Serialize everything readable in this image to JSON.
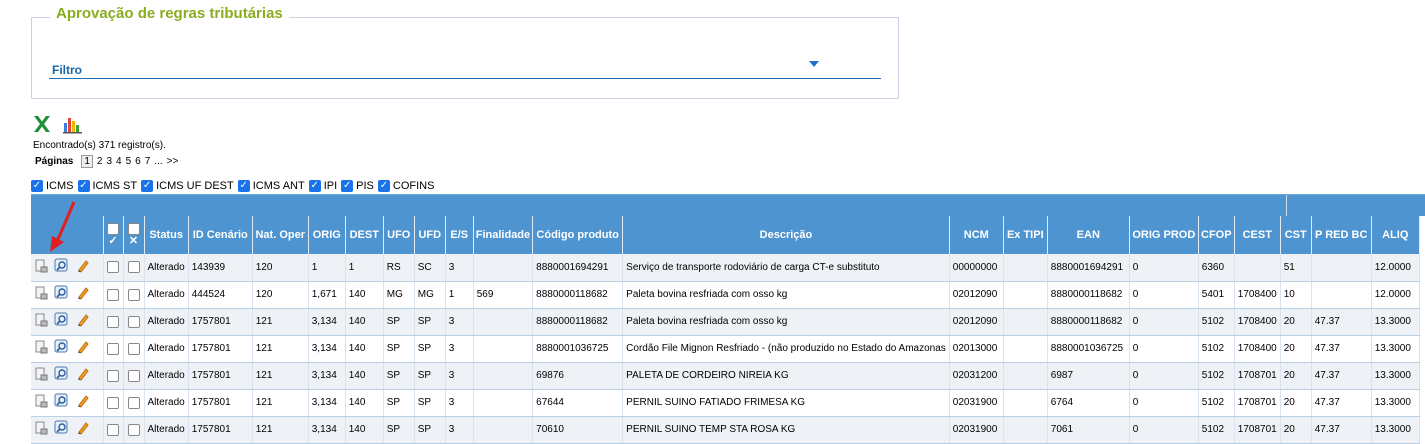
{
  "filter": {
    "title": "Aprovação de regras tributárias",
    "label": "Filtro"
  },
  "toolbar": {
    "excel_icon": "excel-icon",
    "chart_icon": "bar-chart-icon"
  },
  "summary": {
    "found_text": "Encontrado(s) 371 registro(s).",
    "pages_label": "Páginas",
    "pages": [
      "1",
      "2",
      "3",
      "4",
      "5",
      "6",
      "7",
      "...",
      ">>"
    ],
    "current_page": "1"
  },
  "tax_filters": [
    {
      "label": "ICMS",
      "checked": true
    },
    {
      "label": "ICMS ST",
      "checked": true
    },
    {
      "label": "ICMS UF DEST",
      "checked": true
    },
    {
      "label": "ICMS ANT",
      "checked": true
    },
    {
      "label": "IPI",
      "checked": true
    },
    {
      "label": "PIS",
      "checked": true
    },
    {
      "label": "COFINS",
      "checked": true
    }
  ],
  "columns": [
    "Status",
    "ID Cenário",
    "Nat. Oper",
    "ORIG",
    "DEST",
    "UFO",
    "UFD",
    "E/S",
    "Finalidade",
    "Código produto",
    "Descrição",
    "NCM",
    "Ex TIPI",
    "EAN",
    "ORIG PROD",
    "CFOP",
    "CEST",
    "CST",
    "P RED BC",
    "ALIQ"
  ],
  "header_check_symbols": {
    "check": "✓",
    "cross": "✕"
  },
  "rows": [
    [
      "Alterado",
      "143939",
      "120",
      "1",
      "1",
      "RS",
      "SC",
      "3",
      "",
      "8880001694291",
      "Serviço de transporte rodoviário de carga CT-e substituto",
      "00000000",
      "",
      "8880001694291",
      "0",
      "6360",
      "",
      "51",
      "",
      "12.0000"
    ],
    [
      "Alterado",
      "444524",
      "120",
      "1,671",
      "140",
      "MG",
      "MG",
      "1",
      "569",
      "8880000118682",
      "Paleta bovina resfriada com osso kg",
      "02012090",
      "",
      "8880000118682",
      "0",
      "5401",
      "1708400",
      "10",
      "",
      "12.0000"
    ],
    [
      "Alterado",
      "1757801",
      "121",
      "3,134",
      "140",
      "SP",
      "SP",
      "3",
      "",
      "8880000118682",
      "Paleta bovina resfriada com osso kg",
      "02012090",
      "",
      "8880000118682",
      "0",
      "5102",
      "1708400",
      "20",
      "47.37",
      "13.3000"
    ],
    [
      "Alterado",
      "1757801",
      "121",
      "3,134",
      "140",
      "SP",
      "SP",
      "3",
      "",
      "8880001036725",
      "Cordão File Mignon Resfriado - (não produzido no Estado do Amazonas",
      "02013000",
      "",
      "8880001036725",
      "0",
      "5102",
      "1708400",
      "20",
      "47.37",
      "13.3000"
    ],
    [
      "Alterado",
      "1757801",
      "121",
      "3,134",
      "140",
      "SP",
      "SP",
      "3",
      "",
      "69876",
      "PALETA DE CORDEIRO NIREIA KG",
      "02031200",
      "",
      "6987",
      "0",
      "5102",
      "1708701",
      "20",
      "47.37",
      "13.3000"
    ],
    [
      "Alterado",
      "1757801",
      "121",
      "3,134",
      "140",
      "SP",
      "SP",
      "3",
      "",
      "67644",
      "PERNIL SUINO FATIADO FRIMESA KG",
      "02031900",
      "",
      "6764",
      "0",
      "5102",
      "1708701",
      "20",
      "47.37",
      "13.3000"
    ],
    [
      "Alterado",
      "1757801",
      "121",
      "3,134",
      "140",
      "SP",
      "SP",
      "3",
      "",
      "70610",
      "PERNIL SUINO TEMP STA ROSA KG",
      "02031900",
      "",
      "7061",
      "0",
      "5102",
      "1708701",
      "20",
      "47.37",
      "13.3000"
    ]
  ],
  "row_icons": [
    "document-icon",
    "magnifier-icon",
    "pencil-icon"
  ],
  "colors": {
    "header_blue": "#4d94d0",
    "title_green": "#8aad20",
    "arrow_red": "#e02020"
  }
}
